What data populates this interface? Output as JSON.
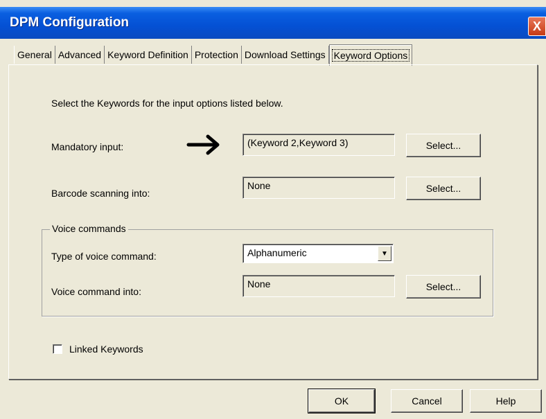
{
  "window": {
    "title": "DPM Configuration",
    "close_glyph": "X"
  },
  "tabs": [
    {
      "label": "General",
      "active": false
    },
    {
      "label": "Advanced",
      "active": false
    },
    {
      "label": "Keyword Definition",
      "active": false
    },
    {
      "label": "Protection",
      "active": false
    },
    {
      "label": "Download Settings",
      "active": false
    },
    {
      "label": "Keyword Options",
      "active": true
    }
  ],
  "content": {
    "instruction": "Select the Keywords for the input options listed below.",
    "mandatory": {
      "label": "Mandatory input:",
      "value": "(Keyword 2,Keyword 3)",
      "button": "Select..."
    },
    "barcode": {
      "label": "Barcode scanning into:",
      "value": "None",
      "button": "Select..."
    },
    "voice": {
      "legend": "Voice commands",
      "type_label": "Type of voice command:",
      "type_value": "Alphanumeric",
      "into_label": "Voice command into:",
      "into_value": "None",
      "button": "Select..."
    },
    "linked": {
      "label": "Linked Keywords",
      "checked": false
    }
  },
  "footer": {
    "ok": "OK",
    "cancel": "Cancel",
    "help": "Help"
  },
  "icons": {
    "arrow": "arrow-right-icon",
    "dropdown": "chevron-down-icon"
  }
}
